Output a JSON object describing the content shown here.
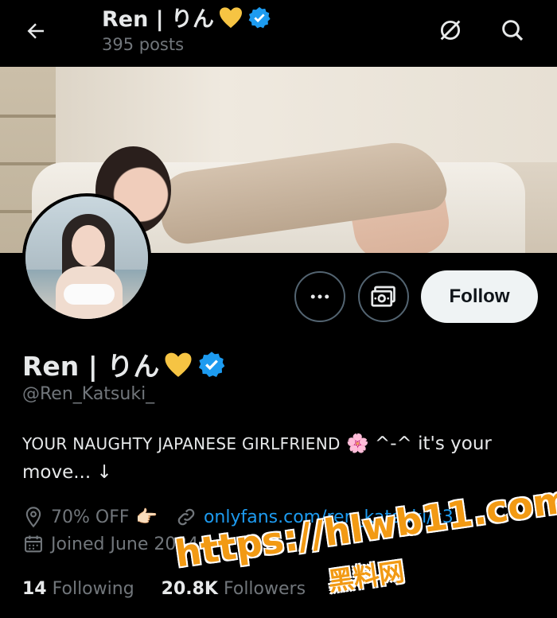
{
  "header": {
    "title": "Ren | りん",
    "posts": "395 posts"
  },
  "icons": {
    "back": "arrow-left-icon",
    "grok": "slash-circle-icon",
    "search": "search-icon",
    "more": "more-horizontal-icon",
    "subscribe": "money-icon",
    "heart": "yellow-heart-emoji",
    "verified": "verified-badge-icon",
    "location": "location-pin-icon",
    "link": "link-icon",
    "calendar": "calendar-icon"
  },
  "profile": {
    "name": "Ren | りん",
    "handle": "@Ren_Katsuki_",
    "follow_label": "Follow",
    "bio_caps": "YOUR NAUGHTY JAPANESE GIRLFRIEND",
    "bio_emoji": "🌸",
    "bio_rest": "^-^ it's your move... ↓",
    "location": "70% OFF",
    "location_emoji": "👉🏻",
    "link": "onlyfans.com/ren_katsuki/c31",
    "joined": "Joined June 2024"
  },
  "stats": {
    "following_count": "14",
    "following_label": "Following",
    "followers_count": "20.8K",
    "followers_label": "Followers"
  },
  "watermark": {
    "url": "https://hlwb11.com",
    "text": "黑料网"
  },
  "colors": {
    "background": "#000000",
    "text_primary": "#e7e9ea",
    "text_secondary": "#71767b",
    "link": "#1d9bf0",
    "verified": "#1d9bf0",
    "follow_bg": "#eff3f4"
  }
}
